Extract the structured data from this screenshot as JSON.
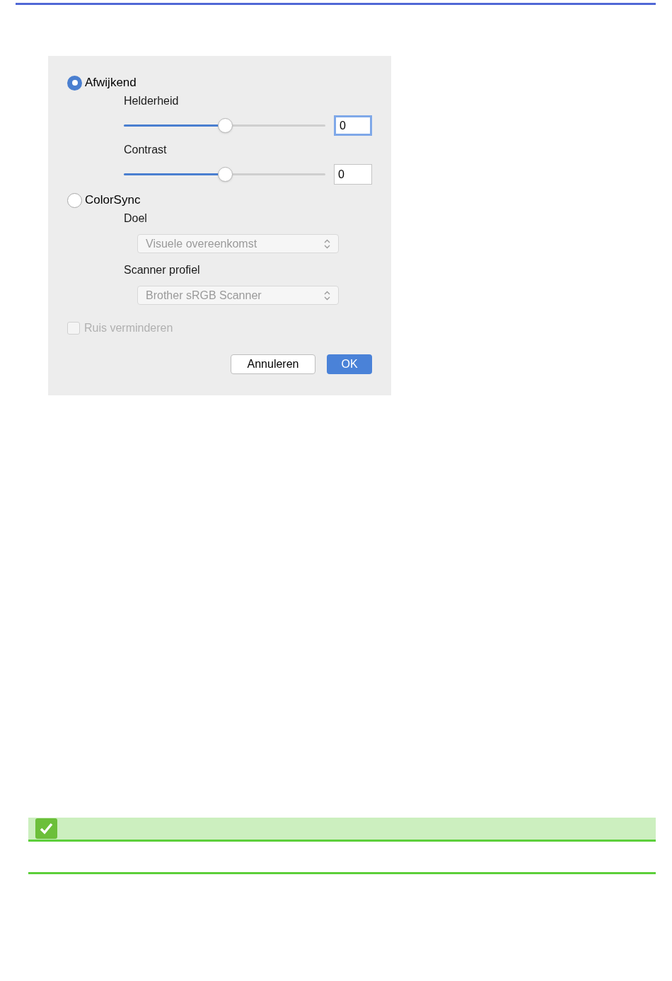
{
  "dialog": {
    "modes": [
      {
        "label": "Afwijkend",
        "selected": true,
        "children": [
          {
            "kind": "slider",
            "label": "Helderheid",
            "level": 0.5,
            "value": "0",
            "focused": true
          },
          {
            "kind": "slider",
            "label": "Contrast",
            "level": 0.5,
            "value": "0",
            "focused": false
          }
        ]
      },
      {
        "label": "ColorSync",
        "selected": false,
        "children": [
          {
            "kind": "select",
            "label": "Doel",
            "value": "Visuele overeenkomst",
            "disabled": true
          },
          {
            "kind": "select",
            "label": "Scanner profiel",
            "value": "Brother sRGB Scanner",
            "disabled": true
          }
        ]
      }
    ],
    "noise_reduction": {
      "label": "Ruis verminderen",
      "checked": false,
      "disabled": true
    },
    "buttons": [
      {
        "label": "Annuleren",
        "kind": "default"
      },
      {
        "label": "OK",
        "kind": "primary"
      }
    ]
  }
}
